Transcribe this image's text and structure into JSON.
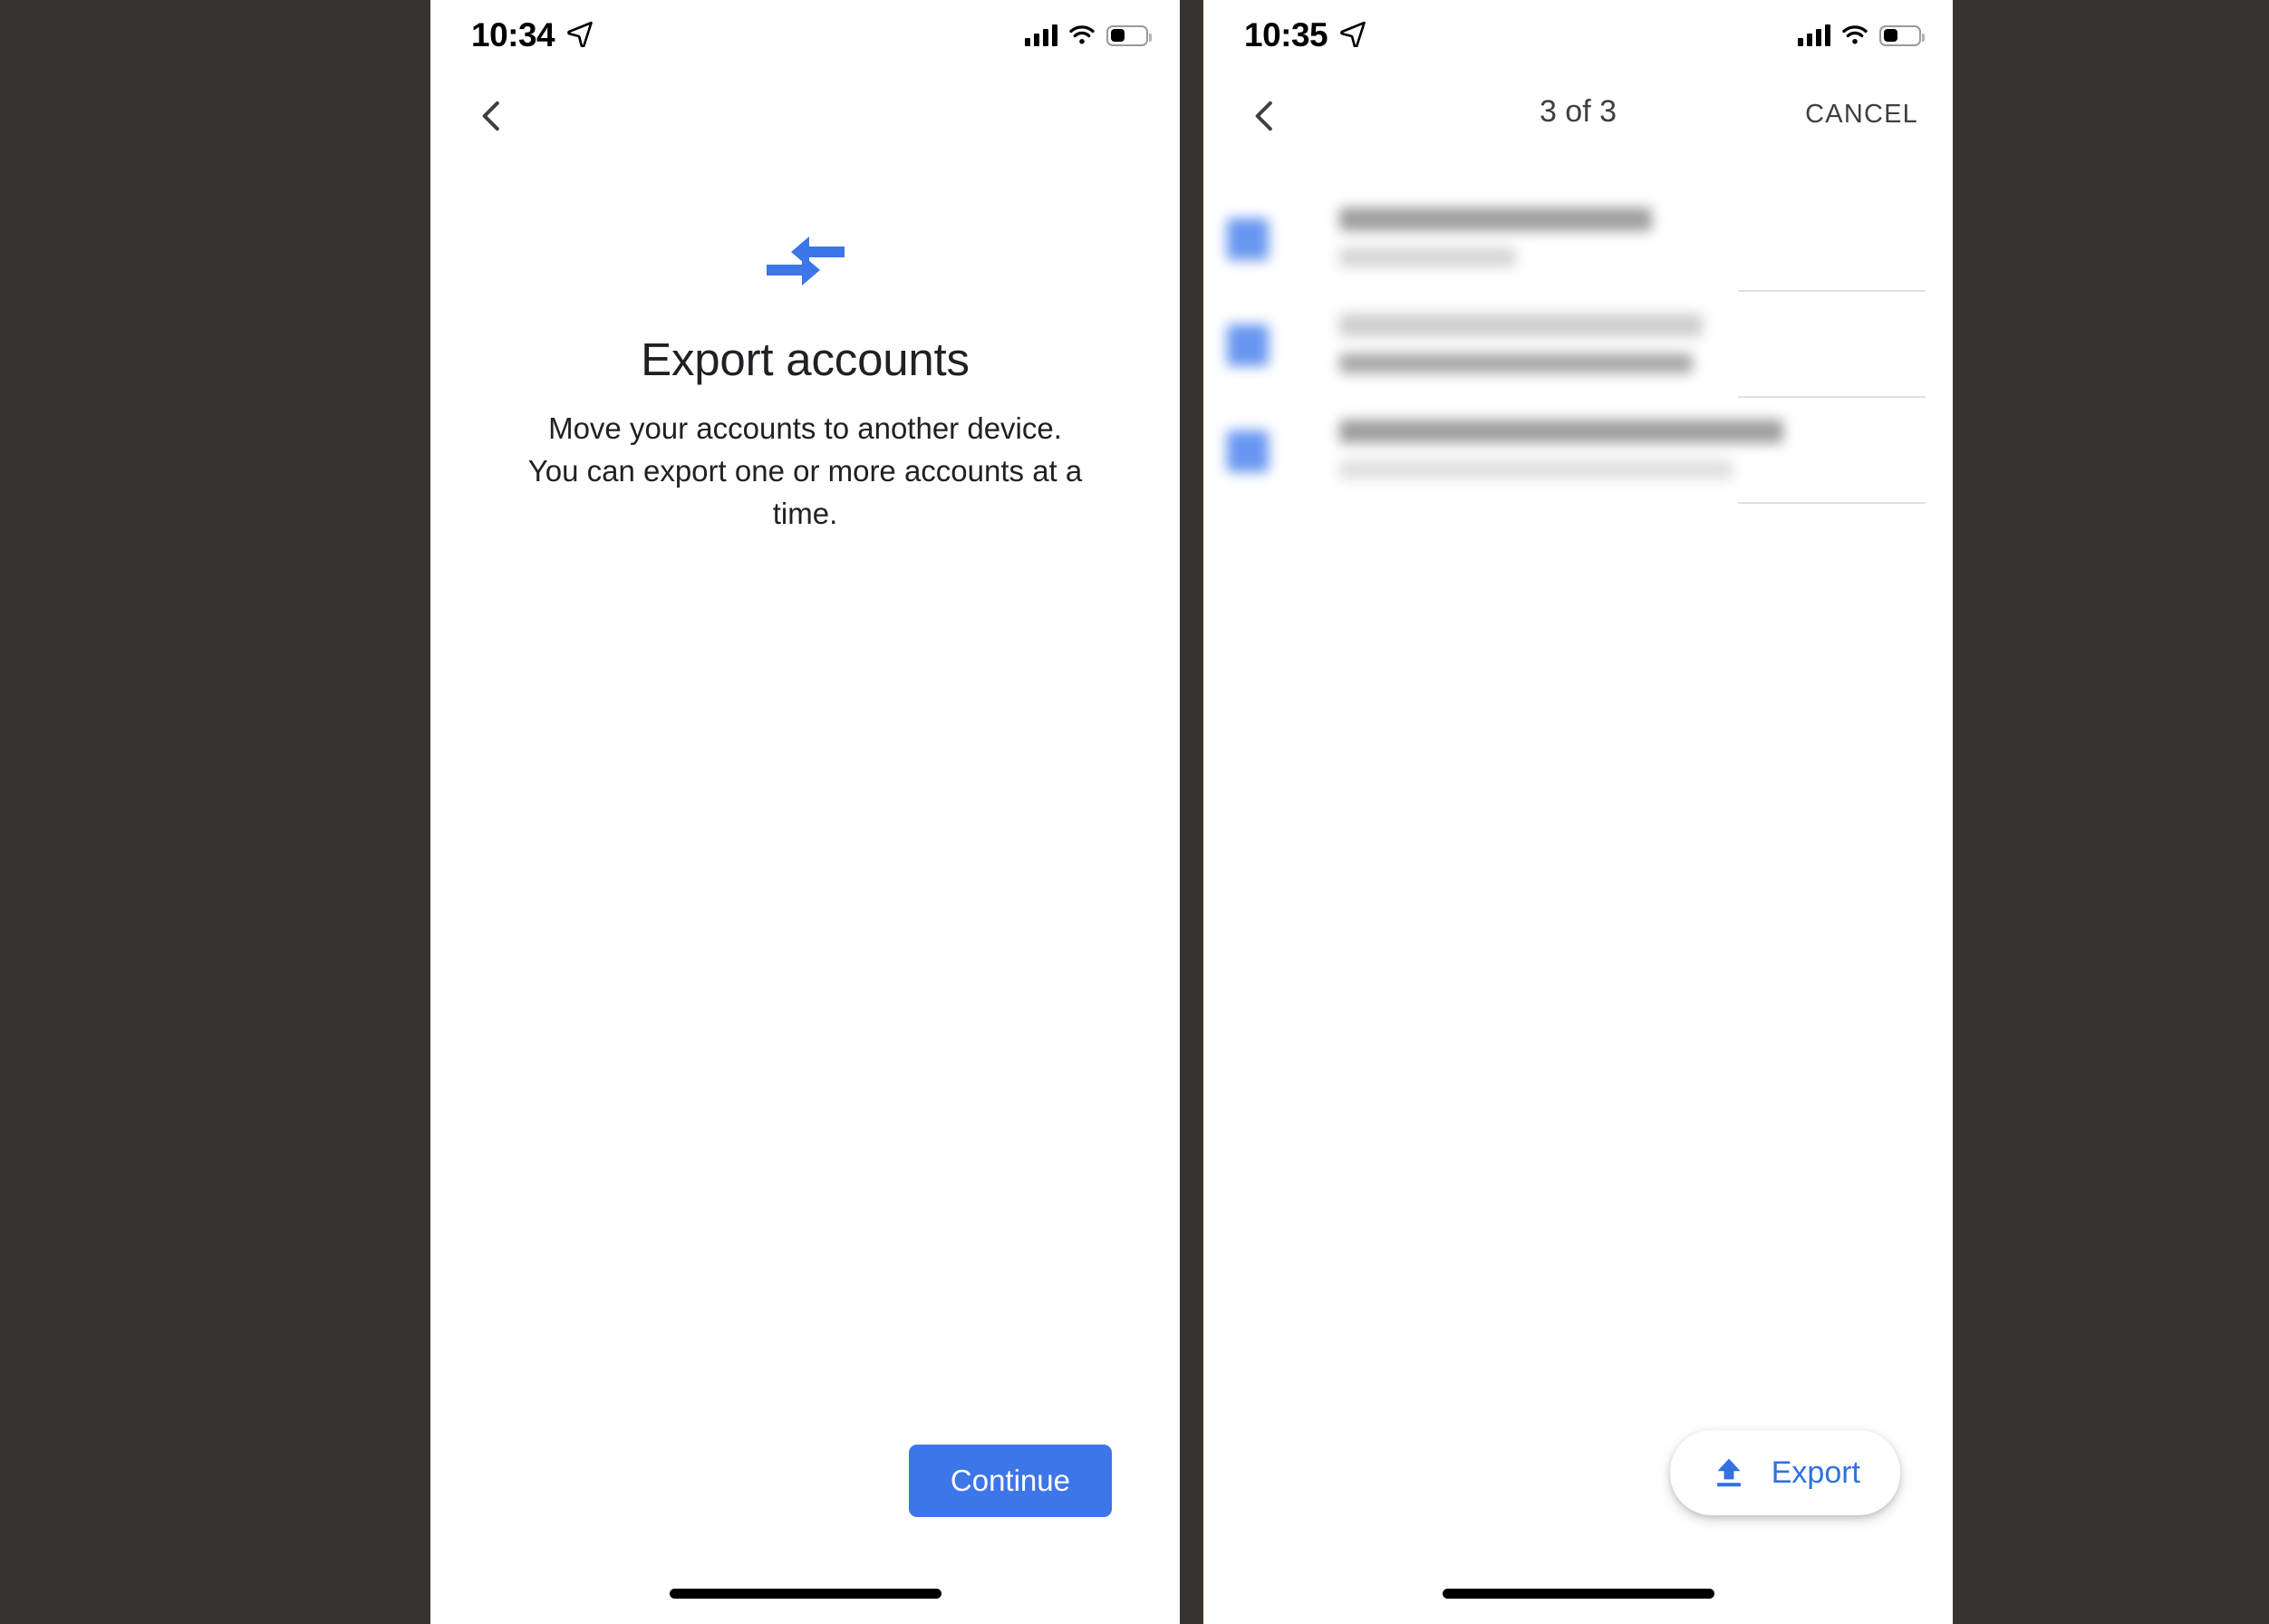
{
  "background_color": "#383431",
  "accent_blue": "#3c76e8",
  "link_blue": "#2f72e0",
  "text_primary": "#202124",
  "text_secondary": "#3c4043",
  "screens": [
    {
      "id": "export-intro",
      "status_bar": {
        "time": "10:34",
        "location_icon": "location-arrow-icon",
        "signal_icon": "cellular-signal-icon",
        "wifi_icon": "wifi-icon",
        "battery_icon": "battery-icon",
        "battery_level_pct": 37
      },
      "nav": {
        "back_icon": "chevron-left-icon",
        "title": "",
        "action": ""
      },
      "hero": {
        "icon": "transfer-arrows-icon",
        "title": "Export accounts",
        "body": "Move your accounts to another device. You can export one or more accounts at a time."
      },
      "primary_button": {
        "label": "Continue"
      },
      "home_indicator": "home-indicator"
    },
    {
      "id": "select-accounts",
      "status_bar": {
        "time": "10:35",
        "location_icon": "location-arrow-icon",
        "signal_icon": "cellular-signal-icon",
        "wifi_icon": "wifi-icon",
        "battery_icon": "battery-icon",
        "battery_level_pct": 37
      },
      "nav": {
        "back_icon": "chevron-left-icon",
        "title": "3 of 3",
        "action": "CANCEL"
      },
      "account_list": {
        "rows": [
          {
            "checked": true,
            "primary": "",
            "secondary": "",
            "primary_width_pct": 62,
            "secondary_width_pct": 35
          },
          {
            "checked": true,
            "primary": "",
            "secondary": "",
            "primary_width_pct": 72,
            "secondary_width_pct": 70
          },
          {
            "checked": true,
            "primary": "",
            "secondary": "",
            "primary_width_pct": 88,
            "secondary_width_pct": 78
          }
        ]
      },
      "fab": {
        "icon": "upload-icon",
        "label": "Export"
      },
      "home_indicator": "home-indicator"
    }
  ]
}
